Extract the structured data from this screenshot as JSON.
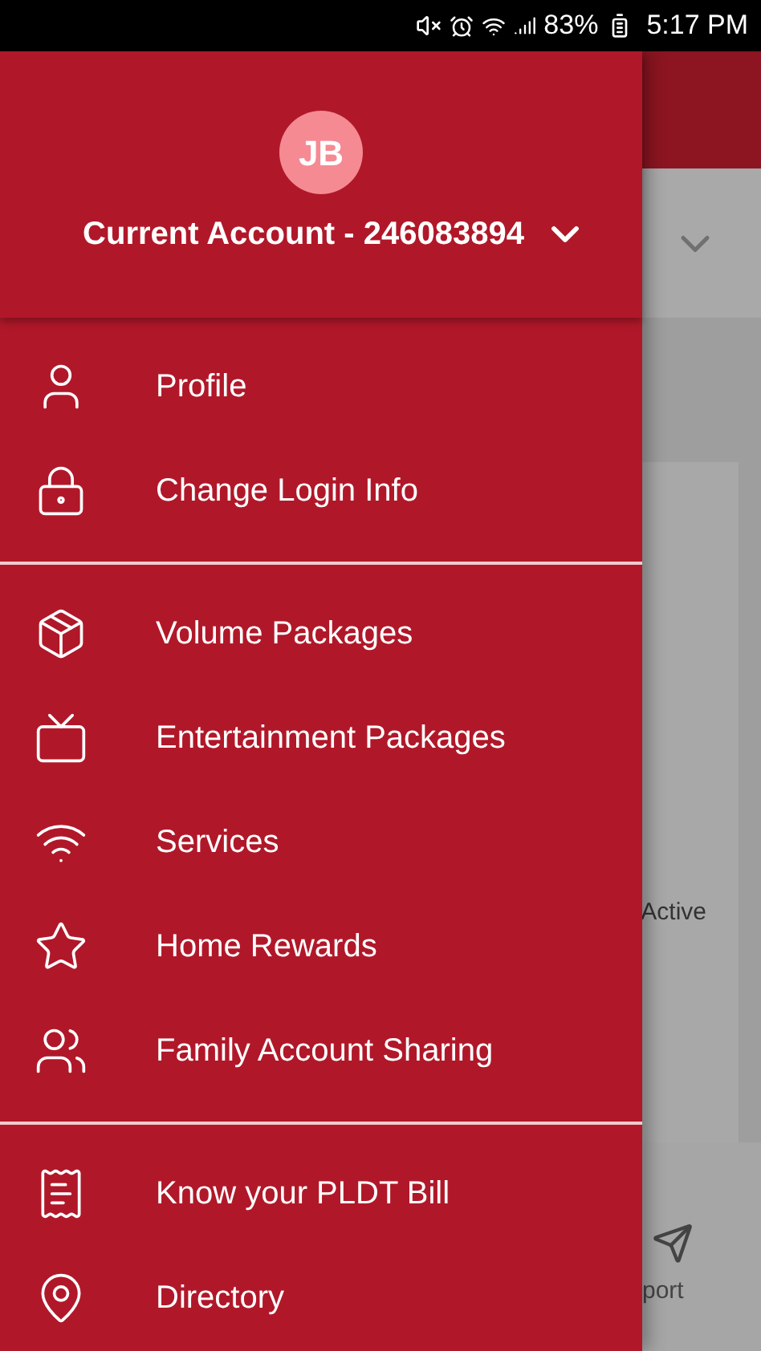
{
  "status_bar": {
    "battery": "83%",
    "time": "5:17 PM"
  },
  "background": {
    "card_label": "Active",
    "nav_label": "port"
  },
  "drawer": {
    "avatar": "JB",
    "account": "Current Account - 246083894",
    "sections": [
      {
        "items": [
          {
            "label": "Profile"
          },
          {
            "label": "Change Login Info"
          }
        ]
      },
      {
        "items": [
          {
            "label": "Volume Packages"
          },
          {
            "label": "Entertainment Packages"
          },
          {
            "label": "Services"
          },
          {
            "label": "Home Rewards"
          },
          {
            "label": "Family Account Sharing"
          }
        ]
      },
      {
        "items": [
          {
            "label": "Know your PLDT Bill"
          },
          {
            "label": "Directory"
          }
        ]
      }
    ]
  }
}
